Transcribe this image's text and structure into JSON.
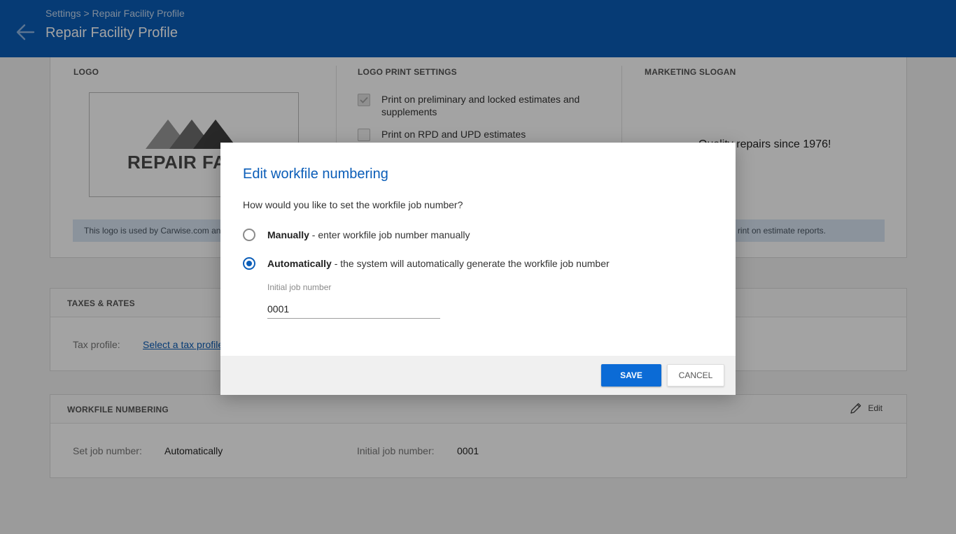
{
  "header": {
    "breadcrumb": "Settings > Repair Facility Profile",
    "title": "Repair Facility Profile",
    "bg_color": "#0a5db8"
  },
  "logo_section": {
    "logo_title": "LOGO",
    "logo_image_text": "REPAIR FACILITY",
    "print_settings_title": "LOGO PRINT SETTINGS",
    "print_options": [
      {
        "label": "Print on preliminary and locked estimates and supplements",
        "checked": true
      },
      {
        "label": "Print on RPD and UPD estimates",
        "checked": false
      }
    ],
    "slogan_title": "MARKETING SLOGAN",
    "slogan": "Quality repairs since 1976!",
    "info_text_left": "This logo is used by Carwise.com an",
    "info_text_right": "rint on estimate reports."
  },
  "taxes": {
    "title": "TAXES & RATES",
    "tax_profile_label": "Tax profile:",
    "tax_profile_link": "Select a tax profile"
  },
  "workfile": {
    "title": "WORKFILE NUMBERING",
    "edit_label": "Edit",
    "set_job_label": "Set job number:",
    "set_job_value": "Automatically",
    "initial_label": "Initial job number:",
    "initial_value": "0001"
  },
  "dialog": {
    "title": "Edit workfile numbering",
    "question": "How would you like to set the workfile job number?",
    "options": [
      {
        "bold": "Manually",
        "rest": " - enter workfile job number manually",
        "selected": false
      },
      {
        "bold": "Automatically",
        "rest": " - the system will automatically generate the workfile job number",
        "selected": true
      }
    ],
    "field_label": "Initial job number",
    "field_value": "0001",
    "save_label": "SAVE",
    "cancel_label": "CANCEL"
  }
}
